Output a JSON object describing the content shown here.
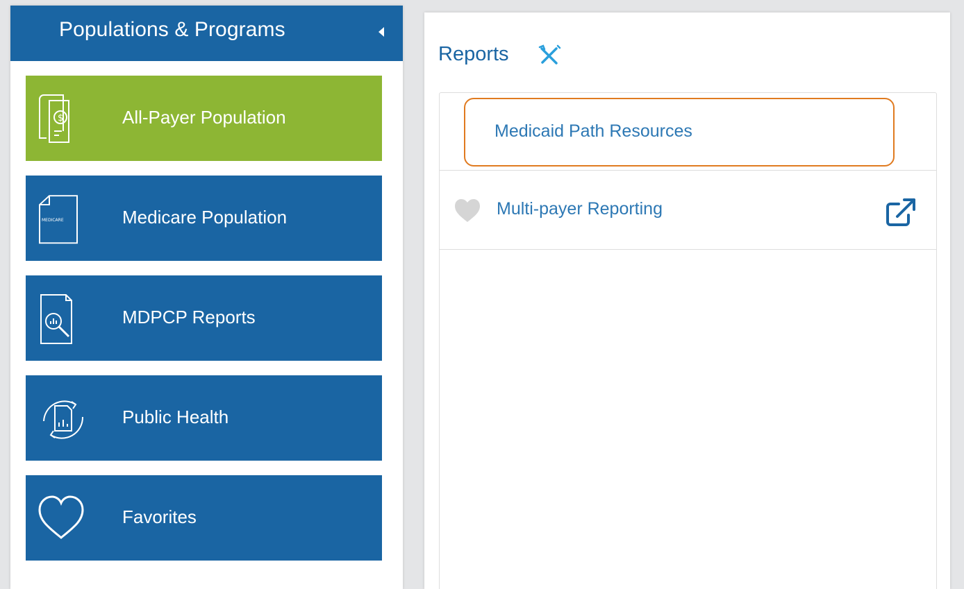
{
  "sidebar": {
    "title": "Populations & Programs",
    "collapse_icon": "caret-left-icon",
    "items": [
      {
        "label": "All-Payer Population",
        "icon": "payer-document-icon",
        "active": true
      },
      {
        "label": "Medicare Population",
        "icon": "medicare-card-icon",
        "icon_text": "MEDICARE",
        "active": false
      },
      {
        "label": "MDPCP Reports",
        "icon": "report-magnifier-icon",
        "active": false
      },
      {
        "label": "Public Health",
        "icon": "refresh-report-icon",
        "active": false
      },
      {
        "label": "Favorites",
        "icon": "heart-icon",
        "active": false
      }
    ]
  },
  "panel": {
    "title": "Reports",
    "tools_icon": "tools-icon",
    "reports": [
      {
        "label": "Medicaid Path Resources",
        "highlighted": true
      },
      {
        "label": "Multi-payer Reporting",
        "favorite_icon": "heart-icon",
        "external_icon": "external-link-icon"
      }
    ]
  },
  "colors": {
    "primary_blue": "#1a65a3",
    "active_green": "#8db634",
    "link_blue": "#2d78b4",
    "highlight_orange": "#e07a1f"
  }
}
